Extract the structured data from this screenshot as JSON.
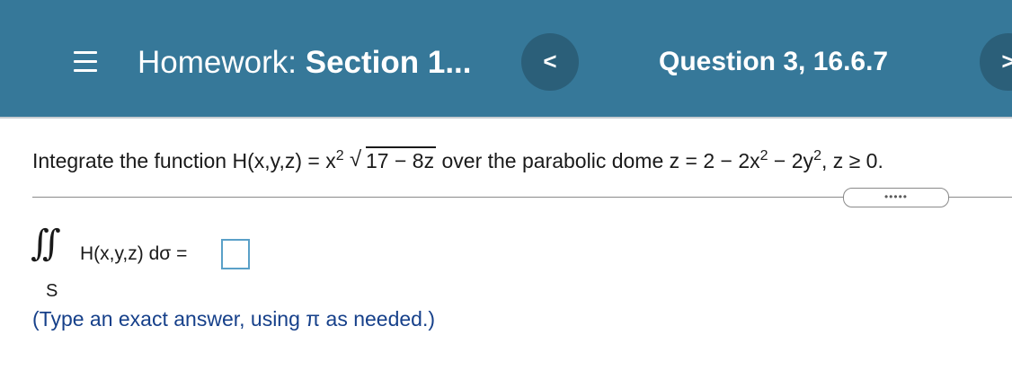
{
  "header": {
    "homework_prefix": "Homework:",
    "homework_section": "Section 1...",
    "question_label": "Question 3, 16.6.7",
    "prev_label": "<",
    "next_label": ">"
  },
  "question": {
    "prompt_start": "Integrate the function H(x,y,z) = x",
    "prompt_exp1": "2",
    "sqrt_symbol": "√",
    "radicand": "17 − 8z",
    "prompt_mid": " over the parabolic dome z = 2 − 2x",
    "prompt_exp2": "2",
    "prompt_mid2": " − 2y",
    "prompt_exp3": "2",
    "prompt_end": ", z ≥ 0.",
    "more_dots": "•••••",
    "integral_symbol": "∫∫",
    "surface_label": "S",
    "integrand": "H(x,y,z) dσ =",
    "answer_value": "",
    "hint": "(Type an exact answer, using π as needed.)"
  },
  "colors": {
    "header_bg": "#367899",
    "nav_button_bg": "#2b5f79",
    "hint_text": "#16408a",
    "answer_box_border": "#5aa0c8"
  },
  "icons": [
    "menu-icon",
    "chevron-left-icon",
    "chevron-right-icon"
  ]
}
